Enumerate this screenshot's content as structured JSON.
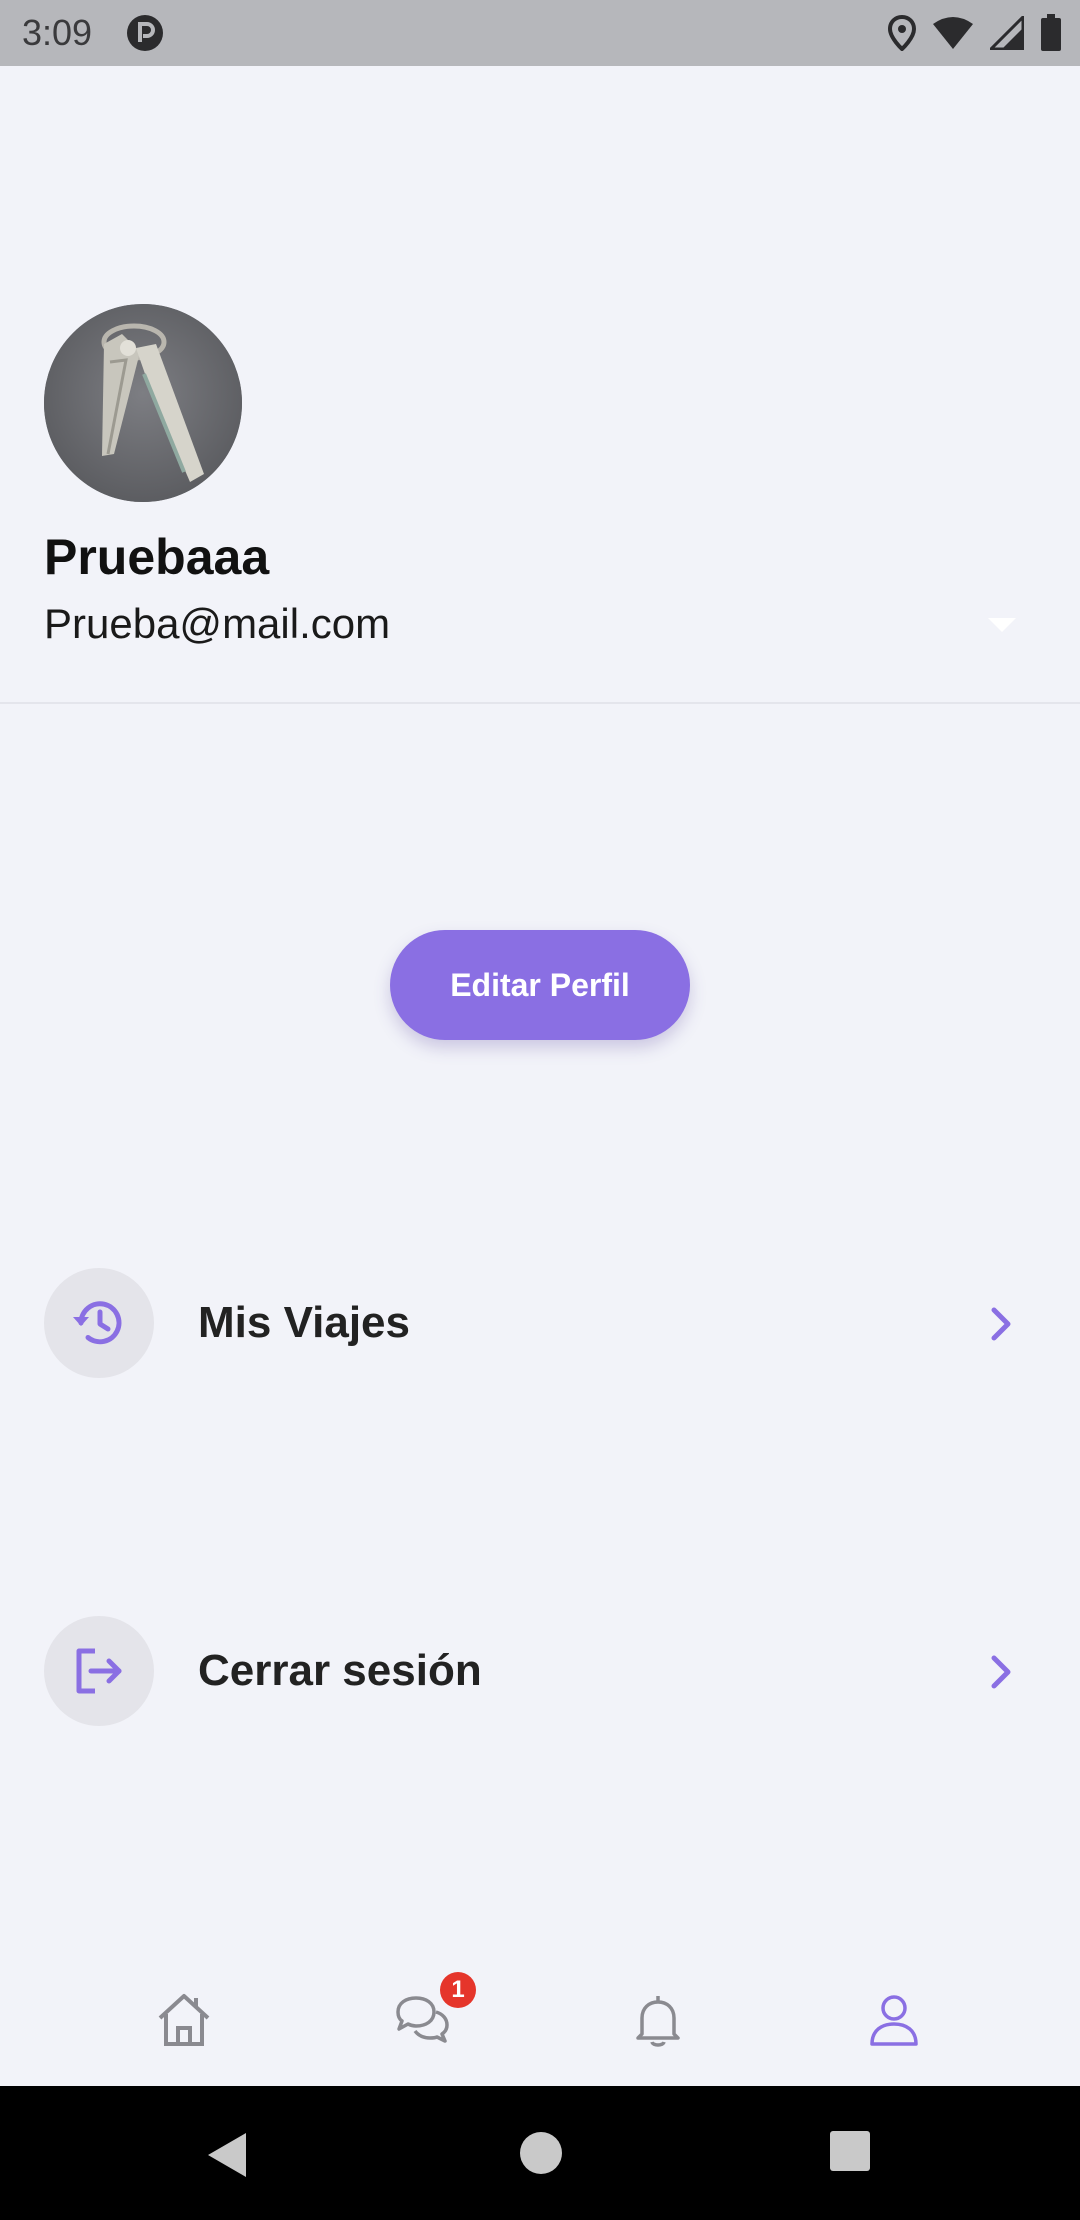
{
  "status_bar": {
    "time": "3:09",
    "app_icon": "pocket-p-icon",
    "icons": [
      "location-icon",
      "wifi-icon",
      "signal-icon",
      "battery-icon"
    ]
  },
  "profile": {
    "name": "Pruebaaa",
    "email": "Prueba@mail.com",
    "avatar": "keys-photo"
  },
  "actions": {
    "edit_profile_label": "Editar Perfil"
  },
  "menu": {
    "items": [
      {
        "label": "Mis Viajes",
        "icon": "history-icon"
      },
      {
        "label": "Cerrar sesión",
        "icon": "logout-icon"
      }
    ]
  },
  "bottom_nav": {
    "items": [
      {
        "icon": "home-icon",
        "active": false
      },
      {
        "icon": "chat-icon",
        "active": false,
        "badge": "1"
      },
      {
        "icon": "bell-icon",
        "active": false
      },
      {
        "icon": "profile-icon",
        "active": true
      }
    ]
  },
  "colors": {
    "accent": "#8a6fe3",
    "background": "#f2f3f9",
    "badge": "#e5352b",
    "inactive_icon": "#8a8a90"
  }
}
